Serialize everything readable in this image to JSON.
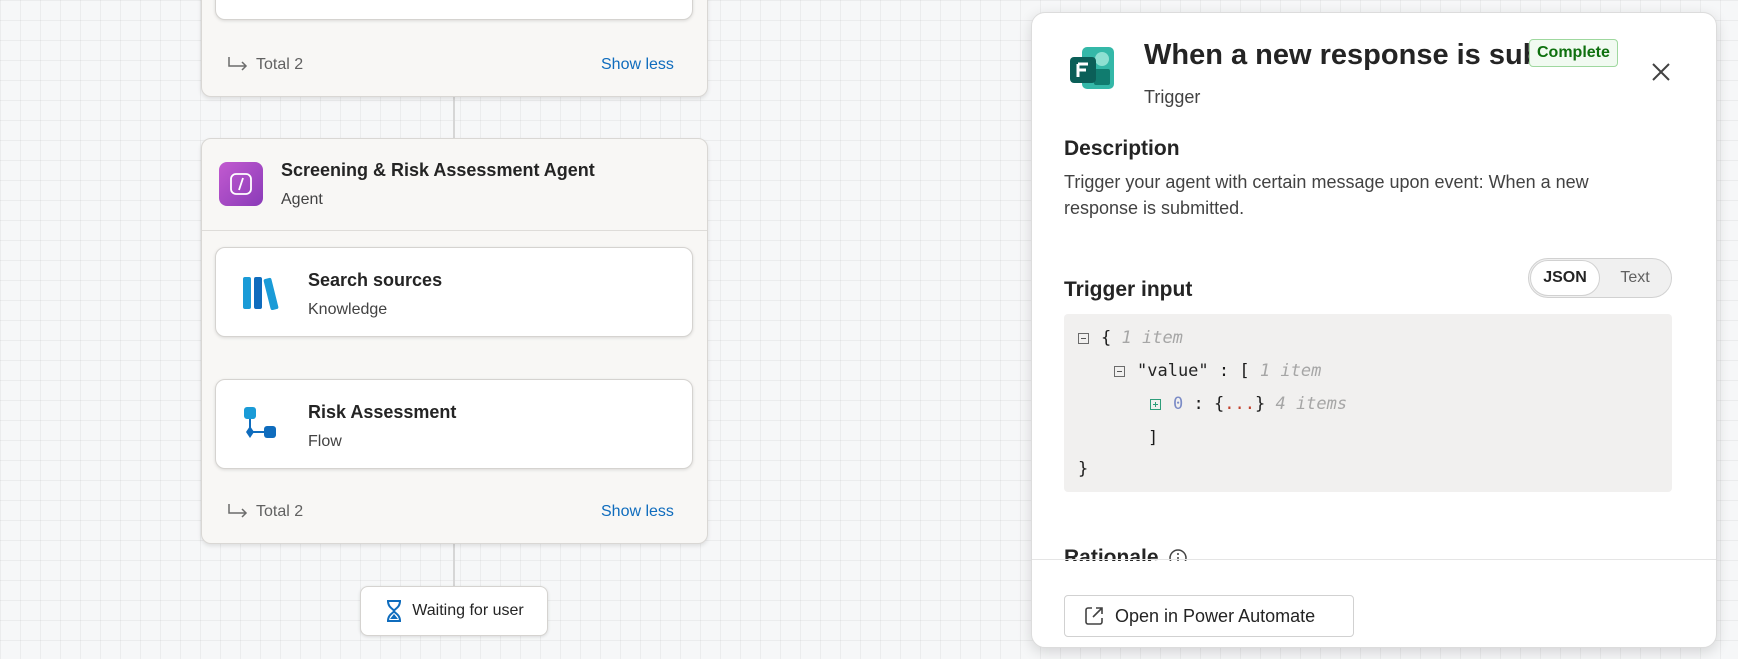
{
  "canvas": {
    "top_group": {
      "total_text": "Total 2",
      "show_less": "Show less"
    },
    "agent_group": {
      "title": "Screening & Risk Assessment Agent",
      "subtitle": "Agent",
      "items": [
        {
          "title": "Search sources",
          "subtitle": "Knowledge",
          "icon": "books-icon"
        },
        {
          "title": "Risk Assessment",
          "subtitle": "Flow",
          "icon": "flow-icon"
        }
      ],
      "total_text": "Total 2",
      "show_less": "Show less"
    },
    "waiting": {
      "label": "Waiting for user",
      "icon": "hourglass-icon"
    }
  },
  "panel": {
    "title": "When a new response is sub...",
    "subtitle": "Trigger",
    "status_badge": "Complete",
    "app_icon": "forms-icon",
    "description_heading": "Description",
    "description_text": "Trigger your agent with certain message upon event: When a new response is submitted.",
    "trigger_input_heading": "Trigger input",
    "toggle": {
      "json_label": "JSON",
      "text_label": "Text",
      "selected": "JSON"
    },
    "json_view": {
      "root_open": "{",
      "root_meta": "1 item",
      "key": "\"value\"",
      "colon": ":",
      "array_open": "[",
      "array_meta": "1 item",
      "index": "0",
      "obj_open": "{",
      "ellipsis": "...",
      "obj_close": "}",
      "obj_meta": "4 items",
      "array_close": "]",
      "root_close": "}"
    },
    "next_section_partial": "Rationale",
    "open_button": "Open in Power Automate"
  },
  "colors": {
    "accent": "#0f6cbd",
    "complete_green": "#0e700e",
    "agent_icon": "#b146c2",
    "knowledge_icon": "#1a9bd7",
    "forms_icon": "#0f7c7b"
  }
}
